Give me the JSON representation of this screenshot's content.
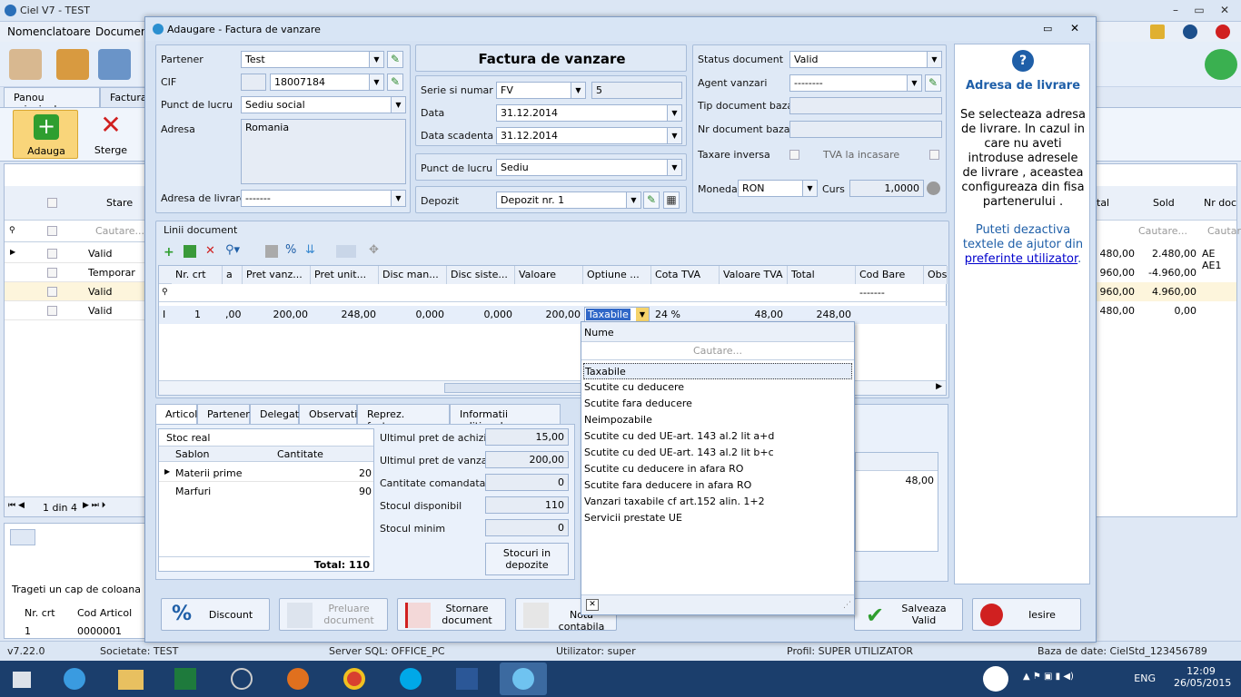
{
  "app": {
    "title": "Ciel V7 - TEST",
    "menu": [
      "Nomenclatoare",
      "Documen"
    ],
    "tabs": [
      "Panou principal",
      "Factura"
    ],
    "ribbon": {
      "add": "Adauga",
      "delete": "Sterge"
    },
    "grid_left": {
      "col_stare": "Stare",
      "search": "Cautare...",
      "rows": [
        "Valid",
        "Temporar",
        "Valid",
        "Valid"
      ],
      "pager": "1 din 4",
      "drag_hint": "Trageti un cap de coloana aici",
      "sub_cols": [
        "Nr. crt",
        "Cod Articol"
      ],
      "sub_row": [
        "1",
        "0000001"
      ]
    },
    "grid_right": {
      "cols": [
        "tal",
        "Sold",
        "Nr doc"
      ],
      "search": [
        "Cautare...",
        "Cautar"
      ],
      "rows": [
        [
          "480,00",
          "2.480,00",
          "AE AE1"
        ],
        [
          "960,00",
          "-4.960,00",
          ""
        ],
        [
          "960,00",
          "4.960,00",
          ""
        ],
        [
          "480,00",
          "0,00",
          ""
        ]
      ]
    }
  },
  "status": {
    "version": "v7.22.0",
    "company": "Societate: TEST",
    "server": "Server SQL: OFFICE_PC",
    "user": "Utilizator: super",
    "profile": "Profil: SUPER UTILIZATOR",
    "db": "Baza de date: CielStd_123456789"
  },
  "taskbar": {
    "lang": "ENG",
    "time": "12:09",
    "date": "26/05/2015"
  },
  "dialog": {
    "title": "Adaugare - Factura de vanzare",
    "partner": {
      "partener_label": "Partener",
      "partener": "Test",
      "cif_label": "CIF",
      "cif": "18007184",
      "punct_label": "Punct de lucru",
      "punct": "Sediu social",
      "adresa_label": "Adresa",
      "adresa": "Romania",
      "livrare_label": "Adresa de livrare",
      "livrare": "-------"
    },
    "doc": {
      "heading": "Factura de vanzare",
      "serie_label": "Serie si numar",
      "serie": "FV",
      "numar": "5",
      "data_label": "Data",
      "data": "31.12.2014",
      "scad_label": "Data scadenta",
      "scad": "31.12.2014",
      "punct_label": "Punct de lucru",
      "punct": "Sediu",
      "depozit_label": "Depozit",
      "depozit": "Depozit nr. 1"
    },
    "status": {
      "status_label": "Status document",
      "status": "Valid",
      "agent_label": "Agent vanzari",
      "agent": "--------",
      "tip_label": "Tip document baza",
      "nr_label": "Nr document baza",
      "taxare_label": "Taxare inversa",
      "tva_label": "TVA la incasare",
      "moneda_label": "Moneda",
      "moneda": "RON",
      "curs_label": "Curs",
      "curs": "1,0000"
    },
    "lines": {
      "title": "Linii document",
      "cols": [
        "Nr. crt",
        "a",
        "Pret vanz...",
        "Pret unit...",
        "Disc man...",
        "Disc siste...",
        "Valoare",
        "Optiune ...",
        "Cota TVA",
        "Valoare TVA",
        "Total",
        "Cod Bare",
        "Obser"
      ],
      "filter_codbare": "-------",
      "row": {
        "nr": "1",
        "a": ",00",
        "pret_vanz": "200,00",
        "pret_unit": "248,00",
        "disc_man": "0,000",
        "disc_sis": "0,000",
        "valoare": "200,00",
        "optiune": "Taxabile",
        "cota": "24 %",
        "val_tva": "48,00",
        "total": "248,00"
      }
    },
    "dropdown": {
      "header": "Nume",
      "search": "Cautare...",
      "items": [
        "Taxabile",
        "Scutite cu deducere",
        "Scutite fara deducere",
        "Neimpozabile",
        "Scutite cu ded UE-art. 143 al.2 lit a+d",
        "Scutite cu ded UE-art. 143 al.2 lit b+c",
        "Scutite cu deducere in afara RO",
        "Scutite fara deducere in afara RO",
        "Vanzari taxabile cf art.152 alin. 1+2",
        "Servicii prestate UE"
      ]
    },
    "tabs": [
      "Articol",
      "Partener",
      "Delegat",
      "Observatii",
      "Reprez. facturare",
      "Informatii aditionale"
    ],
    "stock": {
      "title": "Stoc real",
      "cols": [
        "Sablon",
        "Cantitate"
      ],
      "rows": [
        [
          "Materii prime",
          "20"
        ],
        [
          "Marfuri",
          "90"
        ]
      ],
      "total": "Total: 110"
    },
    "prices": [
      [
        "Ultimul pret de achizitie",
        "15,00"
      ],
      [
        "Ultimul pret de vanzare",
        "200,00"
      ],
      [
        "Cantitate comandata",
        "0"
      ],
      [
        "Stocul disponibil",
        "110"
      ],
      [
        "Stocul minim",
        "0"
      ]
    ],
    "stoc_btn": "Stocuri in depozite",
    "right_val": "48,00",
    "buttons": {
      "discount": "Discount",
      "preluare": "Preluare document",
      "stornare": "Stornare document",
      "nota": "Nota contabila",
      "salveaza": "Salveaza Valid",
      "iesire": "Iesire"
    },
    "help": {
      "title": "Adresa de livrare",
      "body": "Se selecteaza adresa de livrare. In cazul in care nu aveti introduse adresele de livrare , aceastea configureaza din fisa partenerului .",
      "foot1": "Puteti dezactiva textele de ajutor din",
      "link": "preferinte utilizator",
      "dot": "."
    }
  }
}
